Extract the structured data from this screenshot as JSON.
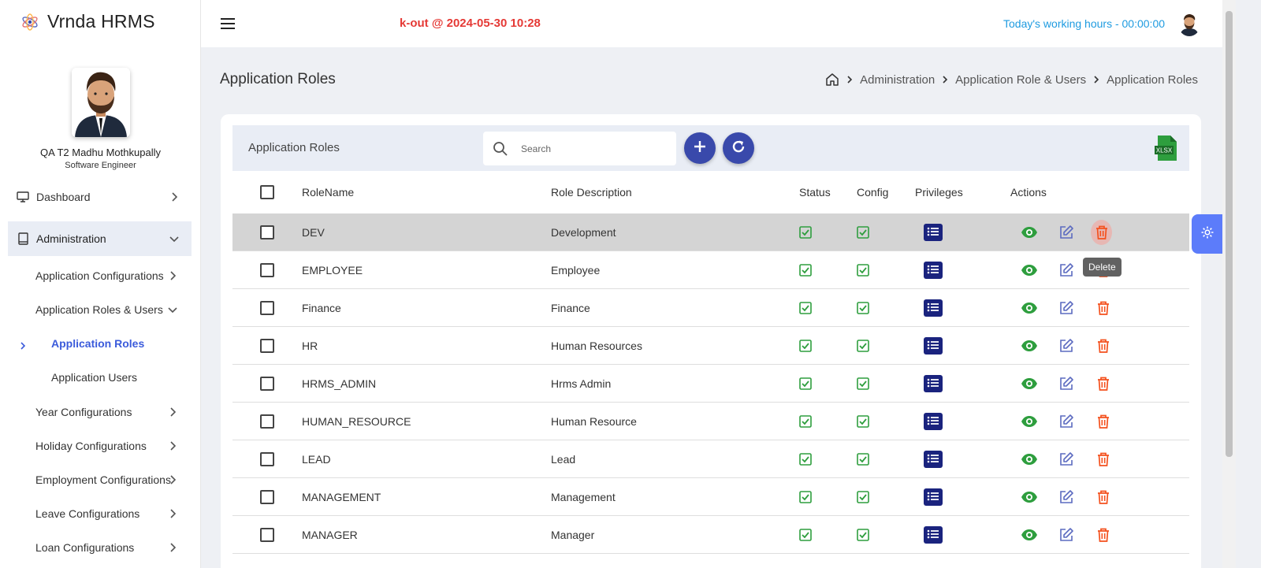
{
  "app": {
    "brand": "Vrnda HRMS"
  },
  "profile": {
    "name": "QA T2 Madhu Mothkupally",
    "role": "Software Engineer"
  },
  "sidebar": {
    "dashboard": "Dashboard",
    "administration": "Administration",
    "items": [
      "Application Configurations",
      "Application Roles & Users",
      "Application Roles",
      "Application Users",
      "Year Configurations",
      "Holiday Configurations",
      "Employment Configurations",
      "Leave Configurations",
      "Loan Configurations"
    ]
  },
  "topbar": {
    "punch_status": "k-out @ 2024-05-30 10:28",
    "working_hours": "Today's working hours - 00:00:00"
  },
  "page": {
    "title": "Application Roles",
    "breadcrumb": [
      "Administration",
      "Application Role & Users",
      "Application Roles"
    ]
  },
  "card": {
    "title": "Application Roles",
    "search_placeholder": "Search",
    "export_label": "XLSX"
  },
  "table": {
    "headers": {
      "name": "RoleName",
      "desc": "Role Description",
      "status": "Status",
      "config": "Config",
      "privileges": "Privileges",
      "actions": "Actions"
    },
    "rows": [
      {
        "name": "DEV",
        "desc": "Development"
      },
      {
        "name": "EMPLOYEE",
        "desc": "Employee"
      },
      {
        "name": "Finance",
        "desc": "Finance"
      },
      {
        "name": "HR",
        "desc": "Human Resources"
      },
      {
        "name": "HRMS_ADMIN",
        "desc": "Hrms Admin"
      },
      {
        "name": "HUMAN_RESOURCE",
        "desc": "Human Resource"
      },
      {
        "name": "LEAD",
        "desc": "Lead"
      },
      {
        "name": "MANAGEMENT",
        "desc": "Management"
      },
      {
        "name": "MANAGER",
        "desc": "Manager"
      }
    ]
  },
  "tooltip": {
    "delete": "Delete"
  },
  "colors": {
    "accent": "#3949ab",
    "success": "#2e9e3e",
    "danger": "#f4511e",
    "punch": "#e53935",
    "hours": "#1e9be0",
    "edit": "#5c6bc0"
  }
}
